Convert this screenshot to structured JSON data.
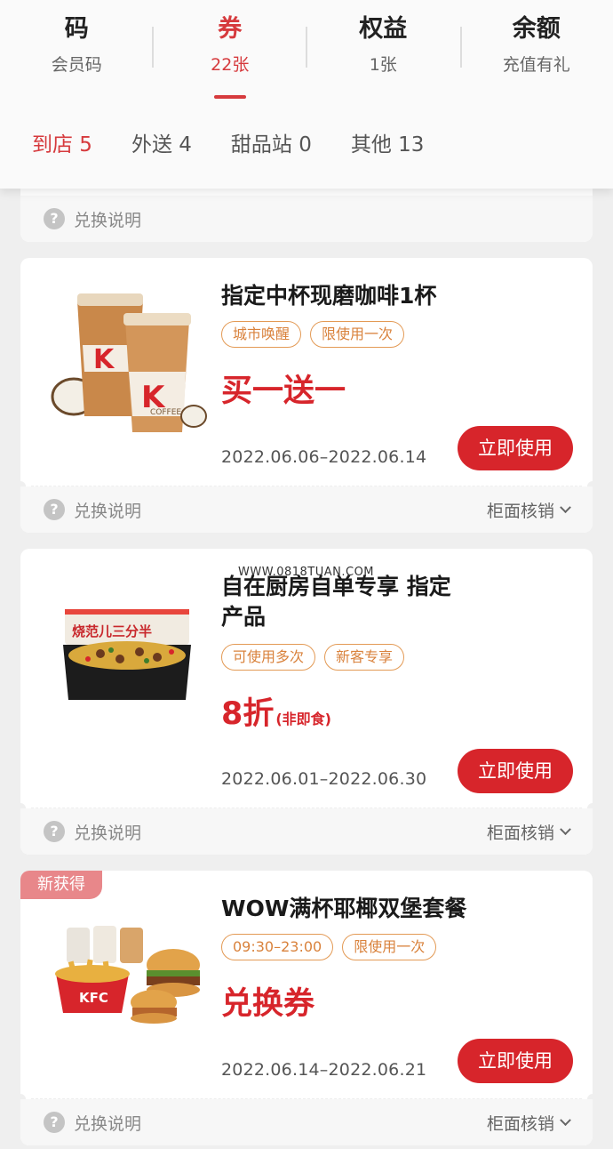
{
  "top_tabs": [
    {
      "title": "码",
      "sub": "会员码"
    },
    {
      "title": "券",
      "sub": "22张"
    },
    {
      "title": "权益",
      "sub": "1张"
    },
    {
      "title": "余额",
      "sub": "充值有礼"
    }
  ],
  "sub_tabs": [
    {
      "label": "到店 5"
    },
    {
      "label": "外送 4"
    },
    {
      "label": "甜品站 0"
    },
    {
      "label": "其他 13"
    }
  ],
  "partial_card": {
    "help_label": "兑换说明"
  },
  "cards": [
    {
      "title": "指定中杯现磨咖啡1杯",
      "tags": [
        "城市唤醒",
        "限使用一次"
      ],
      "offer": "买一送一",
      "offer_note": "",
      "dates": "2022.06.06–2022.06.14",
      "button": "立即使用",
      "help_label": "兑换说明",
      "verify_label": "柜面核销",
      "image": "coffee-cups"
    },
    {
      "title_line1": "自在厨房自单专享 指定",
      "title_line2": "产品",
      "tags": [
        "可使用多次",
        "新客专享"
      ],
      "offer": "8折",
      "offer_note": "(非即食)",
      "dates": "2022.06.01–2022.06.30",
      "button": "立即使用",
      "help_label": "兑换说明",
      "verify_label": "柜面核销",
      "image": "rice-box",
      "image_text": "烧范儿三分半"
    },
    {
      "badge": "新获得",
      "title": "WOW满杯耶椰双堡套餐",
      "tags": [
        "09:30–23:00",
        "限使用一次"
      ],
      "offer": "兑换券",
      "offer_note": "",
      "dates": "2022.06.14–2022.06.21",
      "button": "立即使用",
      "help_label": "兑换说明",
      "verify_label": "柜面核销",
      "image": "burger-combo",
      "image_text": "KFC"
    }
  ],
  "watermark": "WWW.0818TUAN.COM",
  "colors": {
    "accent": "#d7252b",
    "tag": "#e39a55",
    "background": "#efefef"
  }
}
